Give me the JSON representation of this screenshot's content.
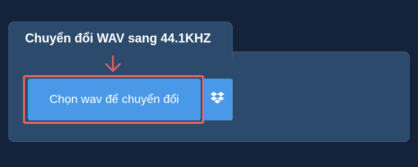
{
  "panel": {
    "title": "Chuyển đổi WAV sang 44.1KHZ"
  },
  "upload": {
    "button_label": "Chọn wav để chuyển đổi",
    "dropbox_icon": "dropbox-icon",
    "arrow_icon": "arrow-down-icon"
  },
  "colors": {
    "background": "#14223a",
    "panel": "#2c4a6b",
    "button": "#4a99e8",
    "highlight": "#e06565"
  }
}
